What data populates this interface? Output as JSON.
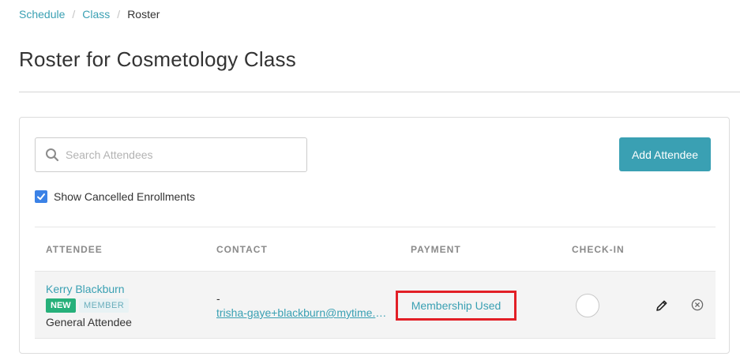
{
  "breadcrumb": {
    "items": [
      {
        "label": "Schedule"
      },
      {
        "label": "Class"
      }
    ],
    "separator": "/",
    "current": "Roster"
  },
  "page_title": "Roster for Cosmetology Class",
  "search": {
    "placeholder": "Search Attendees",
    "value": "",
    "icon": "search-icon"
  },
  "add_attendee_label": "Add Attendee",
  "show_cancelled": {
    "label": "Show Cancelled Enrollments",
    "checked": true
  },
  "table": {
    "headers": {
      "attendee": "ATTENDEE",
      "contact": "CONTACT",
      "payment": "PAYMENT",
      "checkin": "CHECK-IN"
    },
    "rows": [
      {
        "name": "Kerry Blackburn",
        "badge_new": "NEW",
        "badge_member": "MEMBER",
        "attendee_type": "General Attendee",
        "phone": "-",
        "email": "trisha-gaye+blackburn@mytime.com",
        "payment": "Membership Used",
        "checked_in": false
      }
    ]
  },
  "colors": {
    "accent": "#3aa0b3",
    "checkbox": "#3b82e6",
    "badge_new": "#27b07a",
    "highlight_box": "#e21f26"
  }
}
